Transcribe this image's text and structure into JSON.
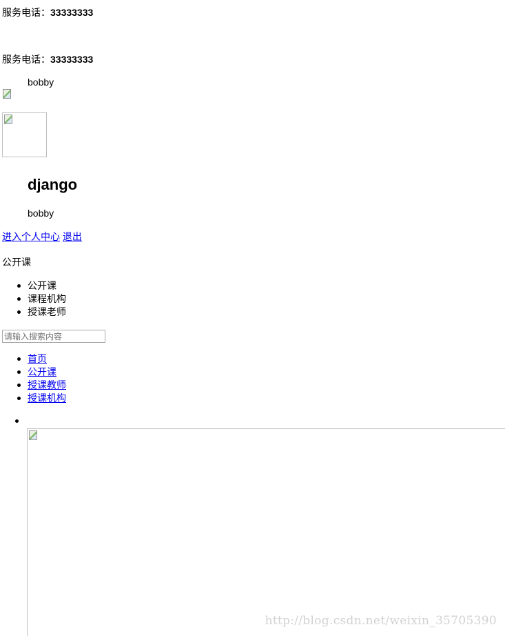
{
  "header": {
    "service_phone_label": "服务电话：",
    "service_phone_number": "33333333"
  },
  "header_fixed": {
    "service_phone_label": "服务电话：",
    "service_phone_number": "33333333"
  },
  "user": {
    "username": "bobby"
  },
  "user_panel": {
    "title": "django",
    "username": "bobby",
    "profile_link": "进入个人中心",
    "logout_link": "退出"
  },
  "search": {
    "type_selected": "公开课",
    "type_options": [
      "公开课",
      "课程机构",
      "授课老师"
    ],
    "placeholder": "请输入搜索内容",
    "value": ""
  },
  "nav": {
    "items": [
      "首页",
      "公开课",
      "授课教师",
      "授课机构"
    ]
  },
  "watermark": "http://blog.csdn.net/weixin_35705390"
}
